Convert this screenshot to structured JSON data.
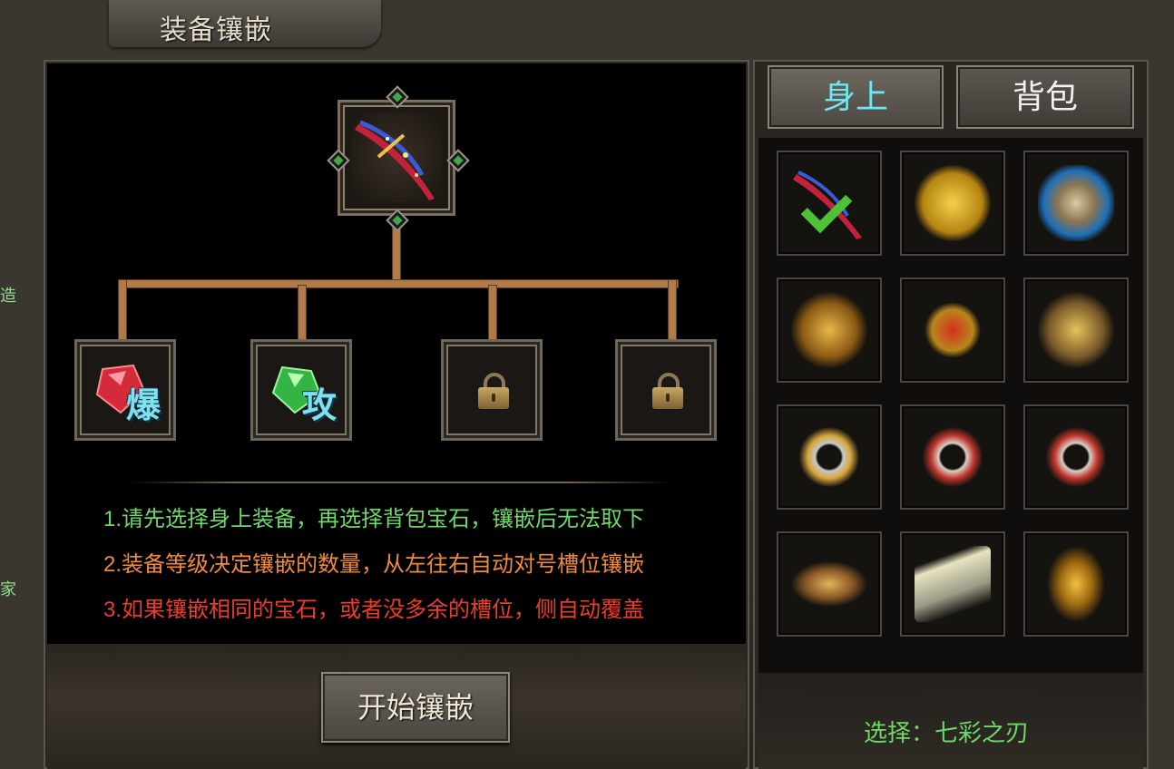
{
  "window": {
    "title": "装备镶嵌"
  },
  "side_chars": [
    "造",
    "家"
  ],
  "equipment_slot": {
    "icon": "seven-color-blade-icon"
  },
  "sockets": [
    {
      "state": "filled",
      "gem": "red-gem-icon",
      "label": "爆",
      "color": "#e0323c"
    },
    {
      "state": "filled",
      "gem": "green-gem-icon",
      "label": "攻",
      "color": "#3fc24a"
    },
    {
      "state": "locked",
      "icon": "lock-icon"
    },
    {
      "state": "locked",
      "icon": "lock-icon"
    }
  ],
  "notes": [
    "1.请先选择身上装备，再选择背包宝石，镶嵌后无法取下",
    "2.装备等级决定镶嵌的数量，从左往右自动对号槽位镶嵌",
    "3.如果镶嵌相同的宝石，或者没多余的槽位，侧自动覆盖"
  ],
  "start_button": {
    "label": "开始镶嵌"
  },
  "tabs": [
    {
      "label": "身上",
      "active": true
    },
    {
      "label": "背包",
      "active": false
    }
  ],
  "equipment_grid": [
    {
      "icon": "blade-icon",
      "selected": true
    },
    {
      "icon": "gold-armor-icon"
    },
    {
      "icon": "blue-hat-icon"
    },
    {
      "icon": "gold-necklace-icon"
    },
    {
      "icon": "red-medal-icon"
    },
    {
      "icon": "gold-helmet-icon"
    },
    {
      "icon": "bracelet-icon"
    },
    {
      "icon": "bracelet-icon"
    },
    {
      "icon": "bracelet-icon"
    },
    {
      "icon": "ring-icon"
    },
    {
      "icon": "silver-boots-icon"
    },
    {
      "icon": "gold-belt-icon"
    }
  ],
  "selection": {
    "text": "选择：七彩之刃"
  },
  "colors": {
    "note1": "#6fd86a",
    "note2": "#f08a3c",
    "note3": "#ef3b2c",
    "active_tab": "#6fe6f2"
  }
}
